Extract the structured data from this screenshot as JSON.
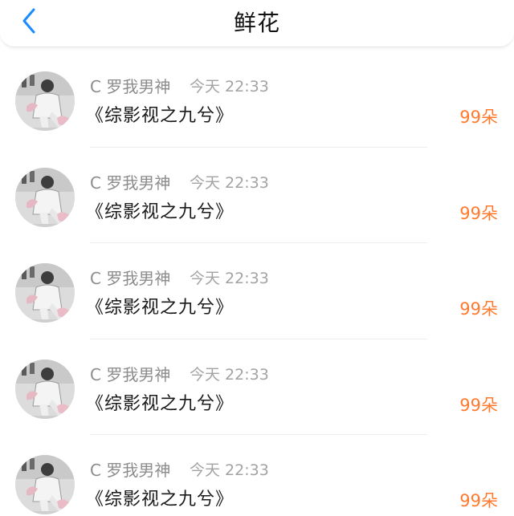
{
  "header": {
    "title": "鲜花",
    "back_icon": "chevron-left-icon"
  },
  "colors": {
    "accent_blue": "#1a8cff",
    "flower_orange": "#ff7a2e"
  },
  "items": [
    {
      "user": "C 罗我男神",
      "time": "今天 22:33",
      "book": "《综影视之九兮》",
      "count": "99朵"
    },
    {
      "user": "C 罗我男神",
      "time": "今天 22:33",
      "book": "《综影视之九兮》",
      "count": "99朵"
    },
    {
      "user": "C 罗我男神",
      "time": "今天 22:33",
      "book": "《综影视之九兮》",
      "count": "99朵"
    },
    {
      "user": "C 罗我男神",
      "time": "今天 22:33",
      "book": "《综影视之九兮》",
      "count": "99朵"
    },
    {
      "user": "C 罗我男神",
      "time": "今天 22:33",
      "book": "《综影视之九兮》",
      "count": "99朵"
    }
  ]
}
